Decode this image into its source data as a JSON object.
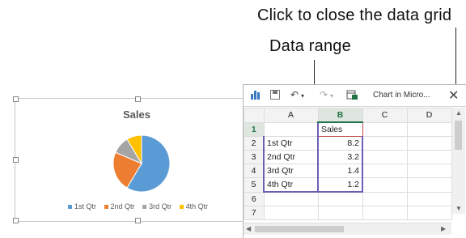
{
  "callouts": {
    "close_grid": "Click to close the data grid",
    "data_range": "Data range"
  },
  "chart": {
    "title": "Sales",
    "legend": [
      "1st Qtr",
      "2nd Qtr",
      "3rd Qtr",
      "4th Qtr"
    ],
    "slice_colors": [
      "#5b9bd5",
      "#ed7d31",
      "#a5a5a5",
      "#ffc000"
    ]
  },
  "chart_data": {
    "type": "pie",
    "title": "Sales",
    "categories": [
      "1st Qtr",
      "2nd Qtr",
      "3rd Qtr",
      "4th Qtr"
    ],
    "values": [
      8.2,
      3.2,
      1.4,
      1.2
    ],
    "legend_position": "bottom"
  },
  "grid_window": {
    "title": "Chart in Micro...",
    "columns": [
      "A",
      "B",
      "C",
      "D"
    ],
    "rows": [
      {
        "num": "1",
        "a": "",
        "b": "Sales"
      },
      {
        "num": "2",
        "a": "1st Qtr",
        "b": "8.2"
      },
      {
        "num": "3",
        "a": "2nd Qtr",
        "b": "3.2"
      },
      {
        "num": "4",
        "a": "3rd Qtr",
        "b": "1.4"
      },
      {
        "num": "5",
        "a": "4th Qtr",
        "b": "1.2"
      },
      {
        "num": "6",
        "a": "",
        "b": ""
      },
      {
        "num": "7",
        "a": "",
        "b": ""
      }
    ],
    "icons": [
      "chart-icon",
      "save-icon",
      "undo-icon",
      "redo-icon",
      "excel-icon",
      "close-icon"
    ]
  }
}
